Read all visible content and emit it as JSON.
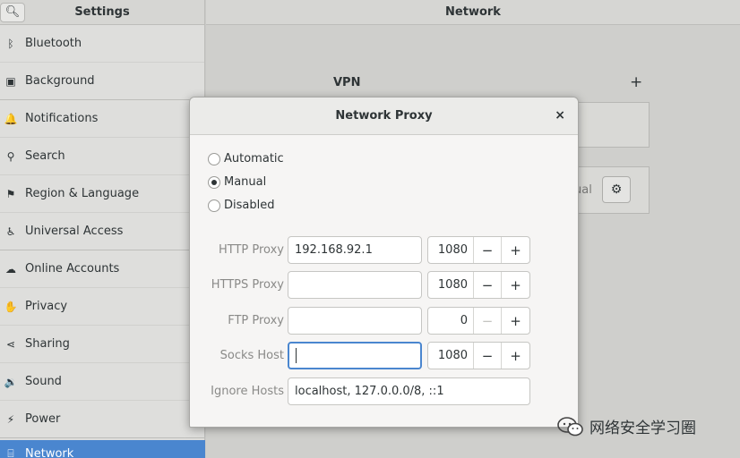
{
  "sidebar": {
    "title": "Settings",
    "search_icon": "search-icon",
    "items": [
      {
        "label": "Bluetooth",
        "icon": "bluetooth-icon",
        "glyph": "ᛒ"
      },
      {
        "label": "Background",
        "icon": "background-icon",
        "glyph": "▣"
      },
      {
        "label": "Notifications",
        "icon": "bell-icon",
        "glyph": "🔔"
      },
      {
        "label": "Search",
        "icon": "search-icon",
        "glyph": "⚲"
      },
      {
        "label": "Region & Language",
        "icon": "flag-icon",
        "glyph": "⚑"
      },
      {
        "label": "Universal Access",
        "icon": "accessibility-icon",
        "glyph": "♿"
      },
      {
        "label": "Online Accounts",
        "icon": "cloud-icon",
        "glyph": "☁"
      },
      {
        "label": "Privacy",
        "icon": "hand-icon",
        "glyph": "✋"
      },
      {
        "label": "Sharing",
        "icon": "share-icon",
        "glyph": "⋖"
      },
      {
        "label": "Sound",
        "icon": "speaker-icon",
        "glyph": "🔉"
      },
      {
        "label": "Power",
        "icon": "power-icon",
        "glyph": "⚡"
      },
      {
        "label": "Network",
        "icon": "network-icon",
        "glyph": "⌸"
      }
    ]
  },
  "main": {
    "title": "Network",
    "vpn_label": "VPN",
    "vpn_add": "+",
    "proxy_status_partial": "ual"
  },
  "dialog": {
    "title": "Network Proxy",
    "close": "×",
    "modes": [
      {
        "label": "Automatic",
        "checked": false
      },
      {
        "label": "Manual",
        "checked": true
      },
      {
        "label": "Disabled",
        "checked": false
      }
    ],
    "fields": [
      {
        "label": "HTTP Proxy",
        "value": "192.168.92.1",
        "port": "1080",
        "minus_enabled": true
      },
      {
        "label": "HTTPS Proxy",
        "value": "",
        "port": "1080",
        "minus_enabled": true
      },
      {
        "label": "FTP Proxy",
        "value": "",
        "port": "0",
        "minus_enabled": false
      },
      {
        "label": "Socks Host",
        "value": "",
        "port": "1080",
        "minus_enabled": true
      }
    ],
    "ignore": {
      "label": "Ignore Hosts",
      "value": "localhost, 127.0.0.0/8, ::1"
    },
    "minus": "−",
    "plus": "+"
  },
  "watermark": {
    "text": "网络安全学习圈",
    "icon": "wechat-icon"
  }
}
